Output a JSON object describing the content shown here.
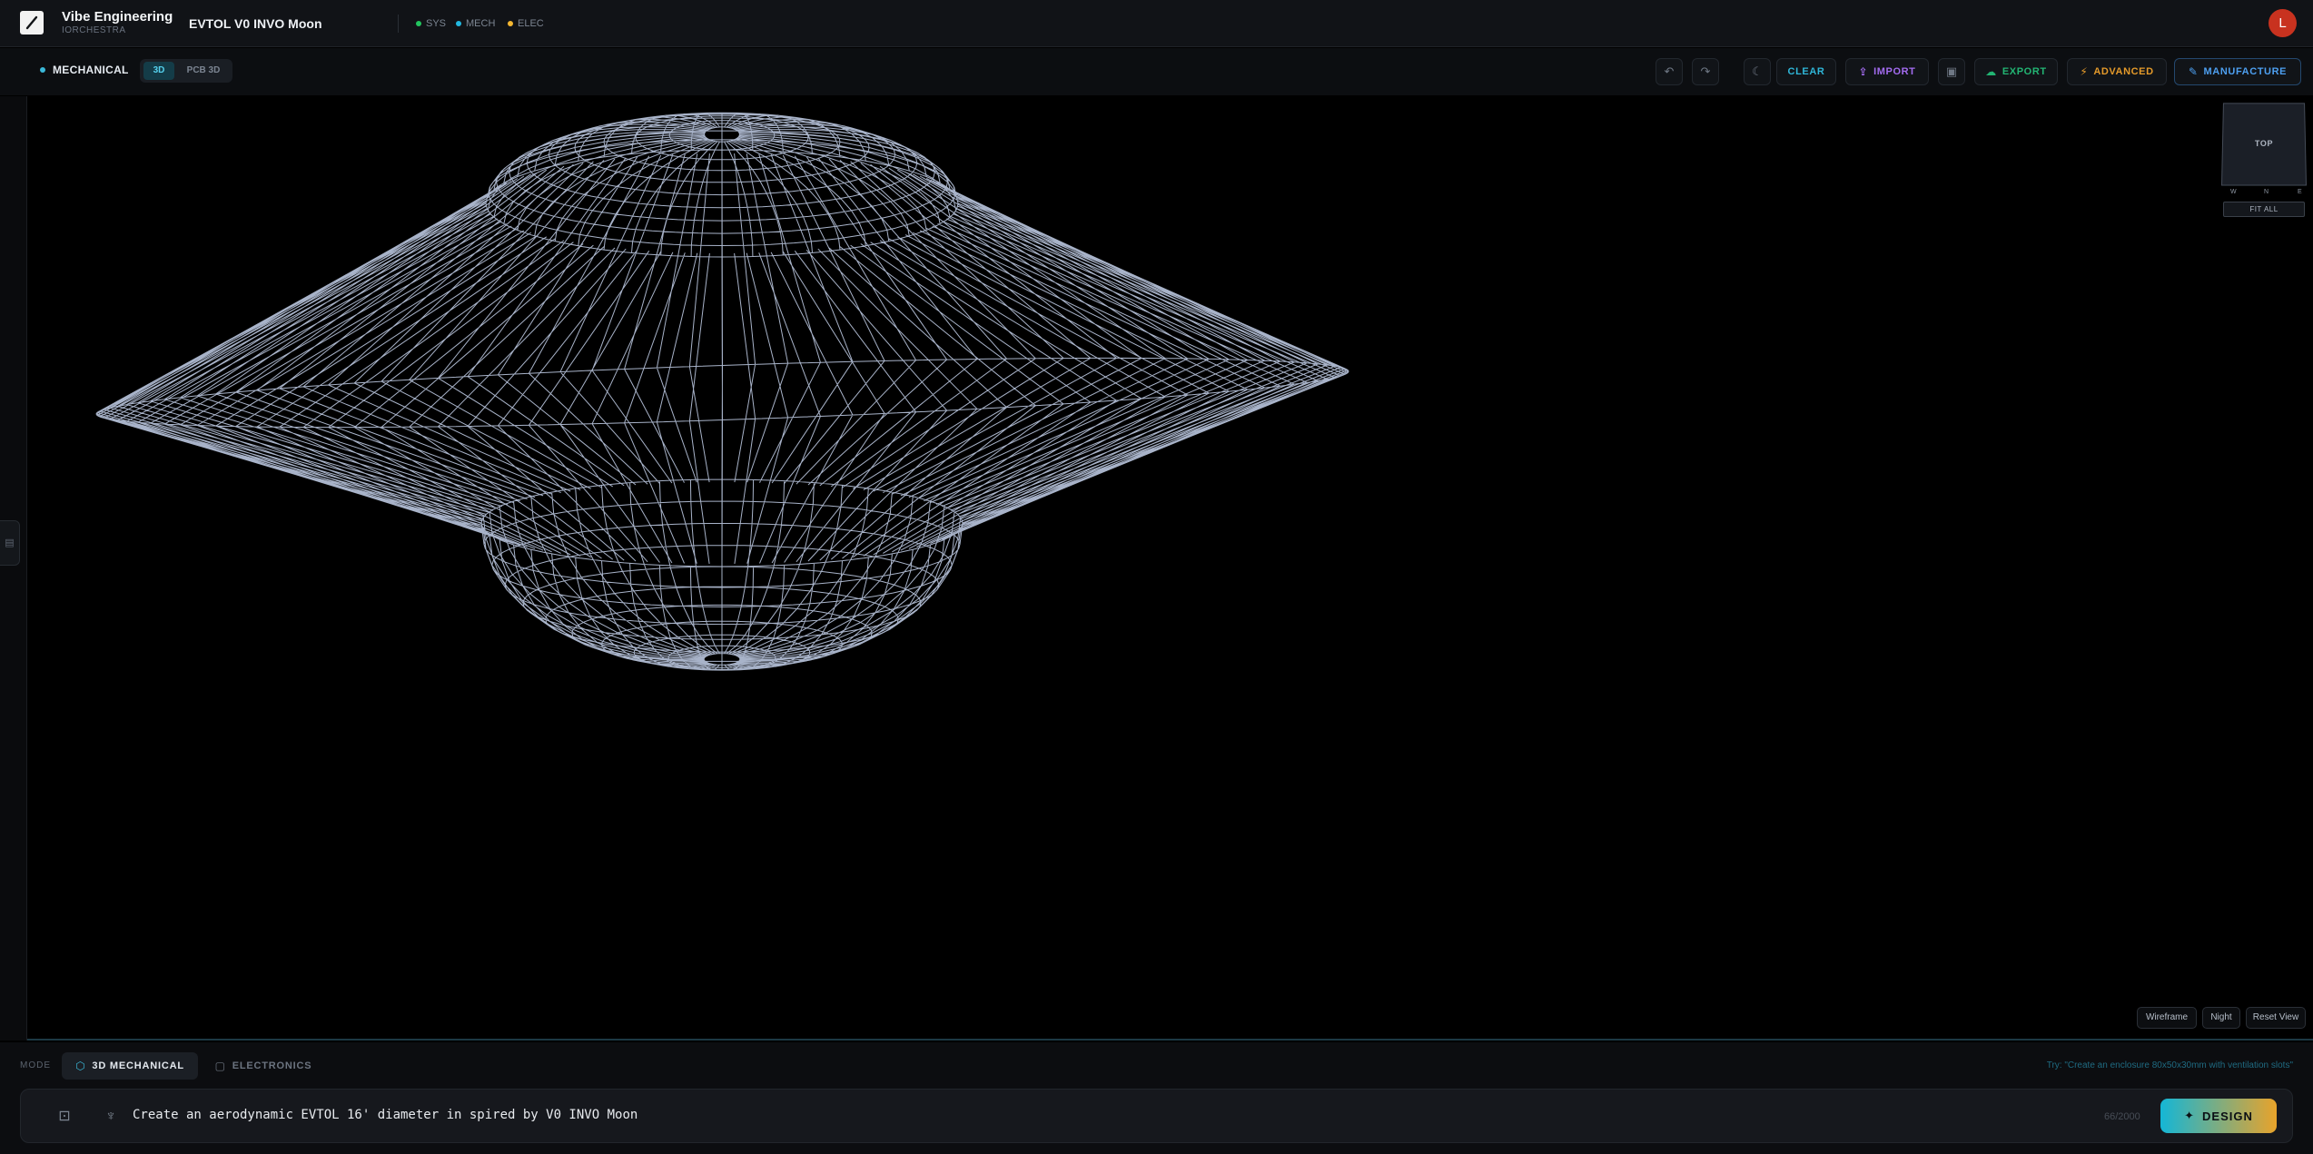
{
  "header": {
    "brand_name": "Vibe Engineering",
    "brand_sub": "IORCHESTRA",
    "project_name": "EVTOL V0 INVO Moon",
    "statuses": [
      {
        "label": "SYS",
        "color": "#22c55e"
      },
      {
        "label": "MECH",
        "color": "#22b8e0"
      },
      {
        "label": "ELEC",
        "color": "#f5b731"
      }
    ],
    "avatar_initial": "L",
    "avatar_color": "#c8321f"
  },
  "toolbar": {
    "mode_label": "MECHANICAL",
    "view_3d": "3D",
    "view_pcb": "PCB 3D",
    "undo_icon": "undo-icon",
    "redo_icon": "redo-icon",
    "theme_icon": "moon-icon",
    "clear_label": "CLEAR",
    "import_label": "IMPORT",
    "panel_icon": "panel-icon",
    "export_label": "EXPORT",
    "advanced_label": "ADVANCED",
    "manufacture_label": "MANUFACTURE",
    "colors": {
      "clear": "#2fb6d8",
      "import": "#a36cf0",
      "export": "#22b573",
      "advanced": "#e49a2a",
      "manufacture": "#4d9ff0"
    }
  },
  "viewport": {
    "view_cube_label": "TOP",
    "compass": {
      "w": "W",
      "n": "N",
      "e": "E"
    },
    "fit_all_label": "FIT ALL",
    "wireframe_label": "Wireframe",
    "night_label": "Night",
    "reset_view_label": "Reset View",
    "mesh_color": "#c5d2ec"
  },
  "bottom": {
    "mode_label": "MODE",
    "mechanical_tab": "3D MECHANICAL",
    "electronics_tab": "ELECTRONICS",
    "hint": "Try: \"Create an enclosure 80x50x30mm with ventilation slots\"",
    "prompt_text": "Create an aerodynamic EVTOL 16' diameter in spired by V0 INVO Moon",
    "char_count": "66/2000",
    "design_label": "DESIGN"
  }
}
